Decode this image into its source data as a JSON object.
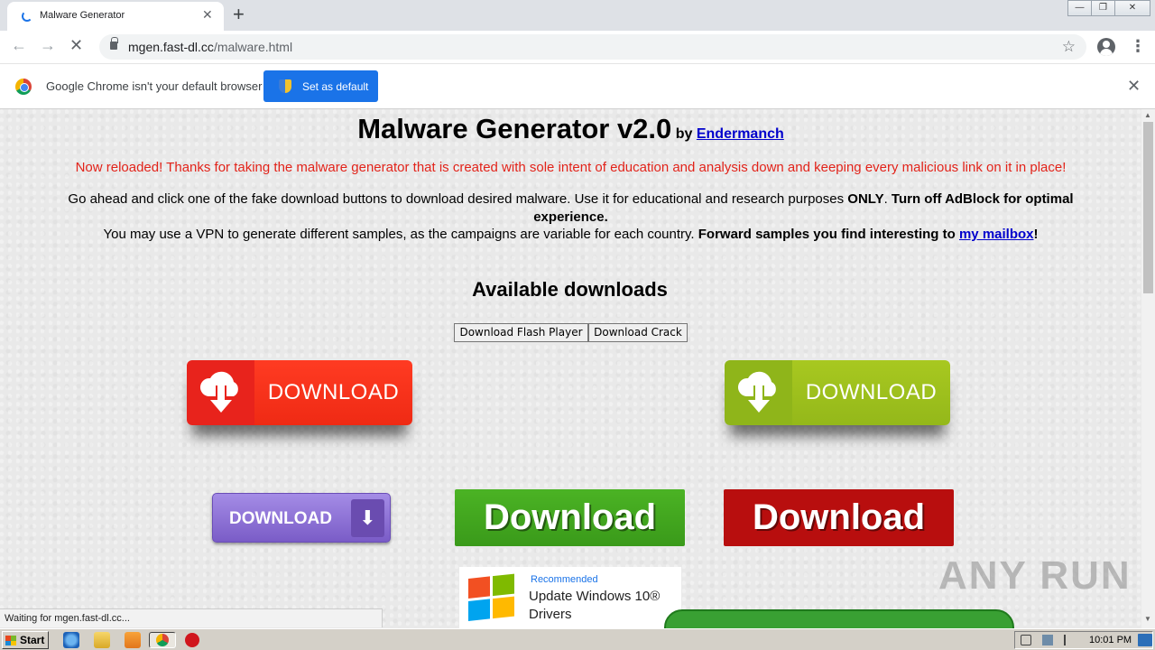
{
  "browser": {
    "tab_title": "Malware Generator",
    "tab_close": "✕",
    "new_tab": "+",
    "url_host": "mgen.fast-dl.cc",
    "url_path": "/malware.html",
    "infobar_message": "Google Chrome isn't your default browser",
    "set_default_label": "Set as default",
    "status_text": "Waiting for mgen.fast-dl.cc..."
  },
  "page": {
    "title": "Malware Generator v2.0",
    "by_label": "by",
    "author": "Endermanch",
    "red_note": "Now reloaded! Thanks for taking the malware generator that is created with sole intent of education and analysis down and keeping every malicious link on it in place!",
    "p1_a": "Go ahead and click one of the fake download buttons to download desired malware. Use it for educational and research purposes ",
    "p1_only": "ONLY",
    "p1_dot": ". ",
    "p1_bold": "Turn off AdBlock for optimal experience.",
    "p2_a": "You may use a VPN to generate different samples, as the campaigns are variable for each country. ",
    "p2_bold": "Forward samples you find interesting to ",
    "p2_link": "my mailbox",
    "p2_end": "!",
    "available": "Available downloads",
    "btn_flash": "Download Flash Player",
    "btn_crack": "Download Crack",
    "big_red_label": "DOWNLOAD",
    "big_green_label": "DOWNLOAD",
    "purple_label": "DOWNLOAD",
    "flat_green_label": "Download",
    "flat_red_label": "Download",
    "win_recommended": "Recommended",
    "win_line1": "Update Windows 10®",
    "win_line2": "Drivers",
    "watermark": "ANY RUN"
  },
  "taskbar": {
    "start": "Start",
    "clock": "10:01 PM"
  },
  "colors": {
    "chrome_blue": "#1a73e8",
    "red_note": "#e2231a",
    "link": "#0000cc"
  }
}
